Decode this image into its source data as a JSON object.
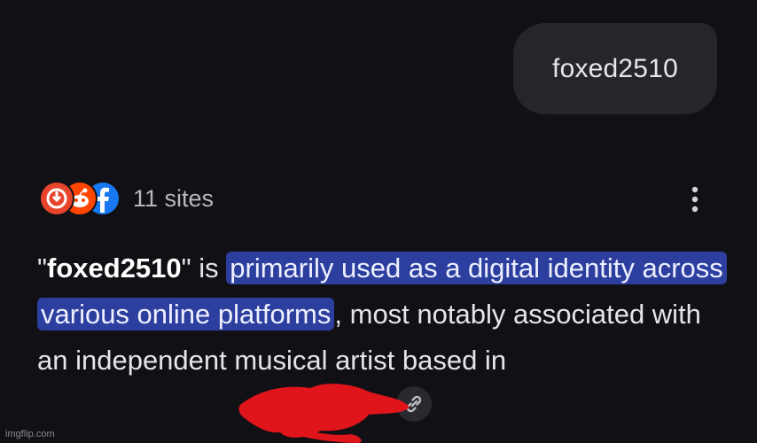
{
  "query": {
    "text": "foxed2510"
  },
  "sources": {
    "count_label": "11 sites",
    "icons": [
      "red-circle-logo-icon",
      "reddit-icon",
      "facebook-icon"
    ]
  },
  "answer": {
    "open_quote": "\"",
    "term": "foxed2510",
    "close_quote_is": "\" is ",
    "highlight": "primarily used as a digital identity across various online platforms",
    "rest": ", most notably associated with an independent musical artist based in "
  },
  "colors": {
    "background": "#111014",
    "bubble": "#26252b",
    "highlight": "#2c3f9e",
    "redaction": "#e0141b"
  },
  "watermark": "imgflip.com"
}
